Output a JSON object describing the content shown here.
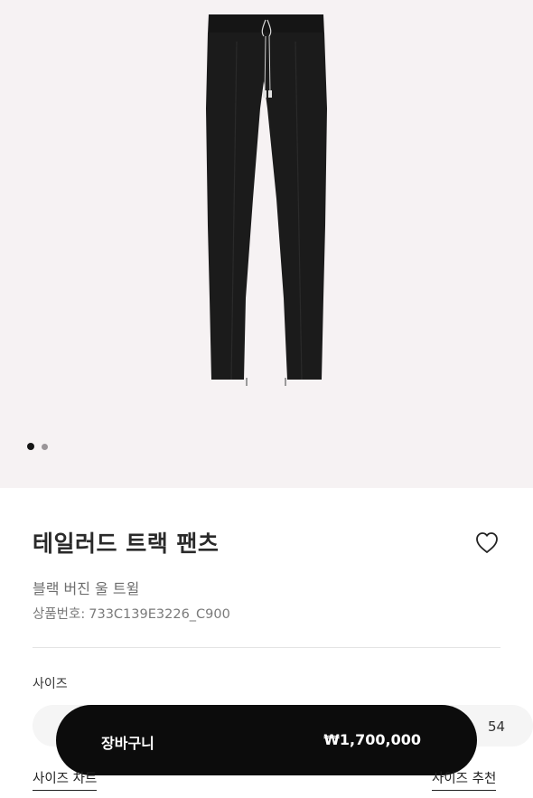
{
  "product": {
    "title": "테일러드 트랙 팬츠",
    "subtitle": "블랙 버진 울 트윌",
    "ref_label": "상품번호:",
    "ref_value": "733C139E3226_C900"
  },
  "gallery": {
    "total_images": 2,
    "current_index": 1
  },
  "sizes": {
    "label": "사이즈",
    "visible_options": [
      "54"
    ]
  },
  "cart": {
    "label": "장바구니",
    "price": "₩1,700,000"
  },
  "links": {
    "size_chart": "사이즈 차트",
    "size_recommend": "사이즈 추천"
  },
  "icons": {
    "wishlist": "heart-outline-icon"
  },
  "colors": {
    "hero_background": "#f6f2f3",
    "cart_button": "#0c0c0c",
    "product_color": "#1b1b1b"
  }
}
